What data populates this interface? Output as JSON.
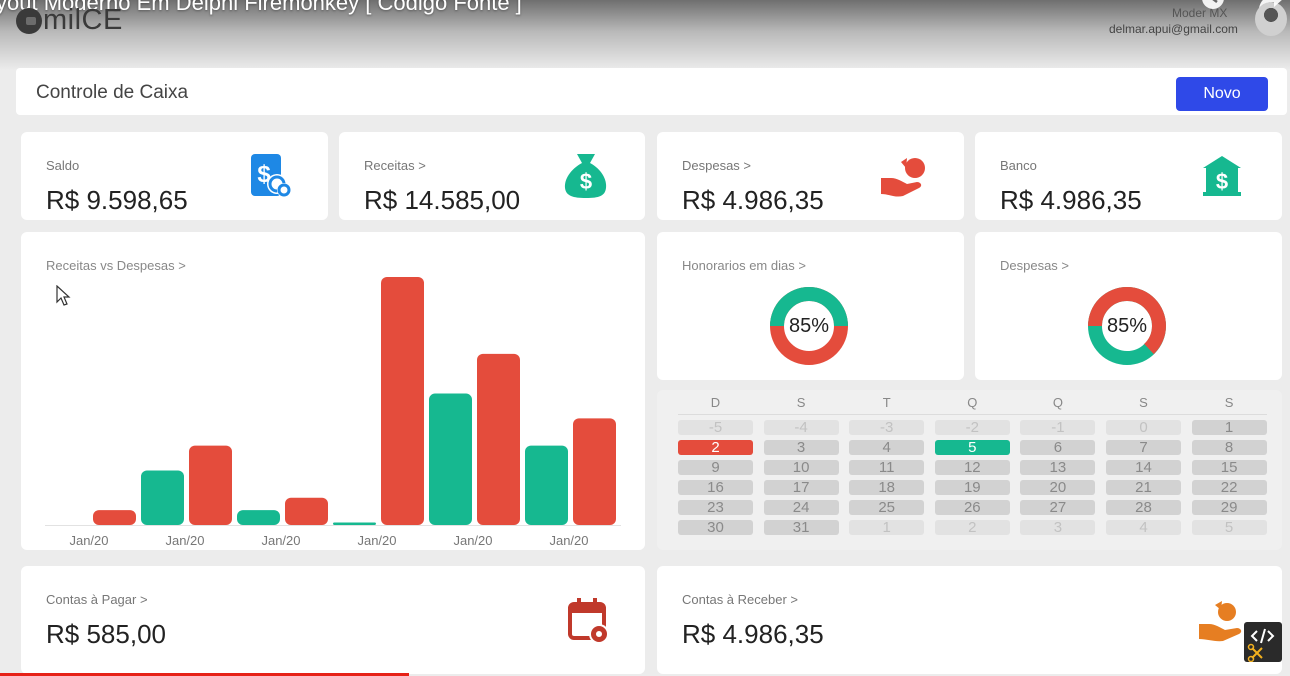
{
  "video": {
    "title": "yout Moderno Em Delphi Firemonkey [ Codigo Fonte ]"
  },
  "brand": {
    "logo_text": "milCE"
  },
  "user": {
    "name": "Moder MX",
    "email": "delmar.apui@gmail.com"
  },
  "header": {
    "title": "Controle de Caixa",
    "new_button": "Novo"
  },
  "cards": {
    "saldo": {
      "label": "Saldo",
      "value": "R$ 9.598,65",
      "icon": "money-transfer-icon",
      "color": "#1e88e5"
    },
    "receitas": {
      "label": "Receitas >",
      "value": "R$ 14.585,00",
      "icon": "money-bag-icon",
      "color": "#16b890"
    },
    "despesas": {
      "label": "Despesas >",
      "value": "R$ 4.986,35",
      "icon": "hand-coin-icon",
      "color": "#e44c3c"
    },
    "banco": {
      "label": "Banco",
      "value": "R$ 4.986,35",
      "icon": "bank-icon",
      "color": "#16b890"
    },
    "contas_pagar": {
      "label": "Contas à Pagar >",
      "value": "R$ 585,00",
      "icon": "calendar-alert-icon",
      "color": "#c0392b"
    },
    "contas_receber": {
      "label": "Contas à Receber >",
      "value": "R$ 4.986,35",
      "icon": "hand-coin-icon",
      "color": "#e67e22"
    }
  },
  "charts": {
    "honorarios": {
      "label": "Honorarios em dias >",
      "percent_text": "85%",
      "percent": 85
    },
    "despesas": {
      "label": "Despesas >",
      "percent_text": "85%",
      "percent": 85
    }
  },
  "chart_data": {
    "type": "bar",
    "title": "Receitas vs Despesas >",
    "tick_labels": [
      "Jan/20",
      "Jan/20",
      "Jan/20",
      "Jan/20",
      "Jan/20",
      "Jan/20"
    ],
    "colors": {
      "receita": "#16b890",
      "despesa": "#e44c3c"
    },
    "bars": [
      {
        "series": "despesa",
        "value": 6
      },
      {
        "series": "receita",
        "value": 22
      },
      {
        "series": "despesa",
        "value": 32
      },
      {
        "series": "receita",
        "value": 6
      },
      {
        "series": "despesa",
        "value": 11
      },
      {
        "series": "receita",
        "value": 1
      },
      {
        "series": "despesa",
        "value": 100
      },
      {
        "series": "receita",
        "value": 53
      },
      {
        "series": "despesa",
        "value": 69
      },
      {
        "series": "receita",
        "value": 32
      },
      {
        "series": "despesa",
        "value": 43
      }
    ],
    "ylim": [
      0,
      100
    ],
    "grid": false
  },
  "calendar": {
    "weekdays": [
      "D",
      "S",
      "T",
      "Q",
      "Q",
      "S",
      "S"
    ],
    "weeks": [
      [
        {
          "d": "-5",
          "s": "muted"
        },
        {
          "d": "-4",
          "s": "muted"
        },
        {
          "d": "-3",
          "s": "muted"
        },
        {
          "d": "-2",
          "s": "muted"
        },
        {
          "d": "-1",
          "s": "muted"
        },
        {
          "d": "0",
          "s": "muted"
        },
        {
          "d": "1",
          "s": "normal"
        }
      ],
      [
        {
          "d": "2",
          "s": "red"
        },
        {
          "d": "3",
          "s": "normal"
        },
        {
          "d": "4",
          "s": "normal"
        },
        {
          "d": "5",
          "s": "green"
        },
        {
          "d": "6",
          "s": "normal"
        },
        {
          "d": "7",
          "s": "normal"
        },
        {
          "d": "8",
          "s": "normal"
        }
      ],
      [
        {
          "d": "9",
          "s": "normal"
        },
        {
          "d": "10",
          "s": "normal"
        },
        {
          "d": "11",
          "s": "normal"
        },
        {
          "d": "12",
          "s": "normal"
        },
        {
          "d": "13",
          "s": "normal"
        },
        {
          "d": "14",
          "s": "normal"
        },
        {
          "d": "15",
          "s": "normal"
        }
      ],
      [
        {
          "d": "16",
          "s": "normal"
        },
        {
          "d": "17",
          "s": "normal"
        },
        {
          "d": "18",
          "s": "normal"
        },
        {
          "d": "19",
          "s": "normal"
        },
        {
          "d": "20",
          "s": "normal"
        },
        {
          "d": "21",
          "s": "normal"
        },
        {
          "d": "22",
          "s": "normal"
        }
      ],
      [
        {
          "d": "23",
          "s": "normal"
        },
        {
          "d": "24",
          "s": "normal"
        },
        {
          "d": "25",
          "s": "normal"
        },
        {
          "d": "26",
          "s": "normal"
        },
        {
          "d": "27",
          "s": "normal"
        },
        {
          "d": "28",
          "s": "normal"
        },
        {
          "d": "29",
          "s": "normal"
        }
      ],
      [
        {
          "d": "30",
          "s": "normal"
        },
        {
          "d": "31",
          "s": "normal"
        },
        {
          "d": "1",
          "s": "muted"
        },
        {
          "d": "2",
          "s": "muted"
        },
        {
          "d": "3",
          "s": "muted"
        },
        {
          "d": "4",
          "s": "muted"
        },
        {
          "d": "5",
          "s": "muted"
        }
      ]
    ]
  },
  "player": {
    "progress": 0.317
  }
}
